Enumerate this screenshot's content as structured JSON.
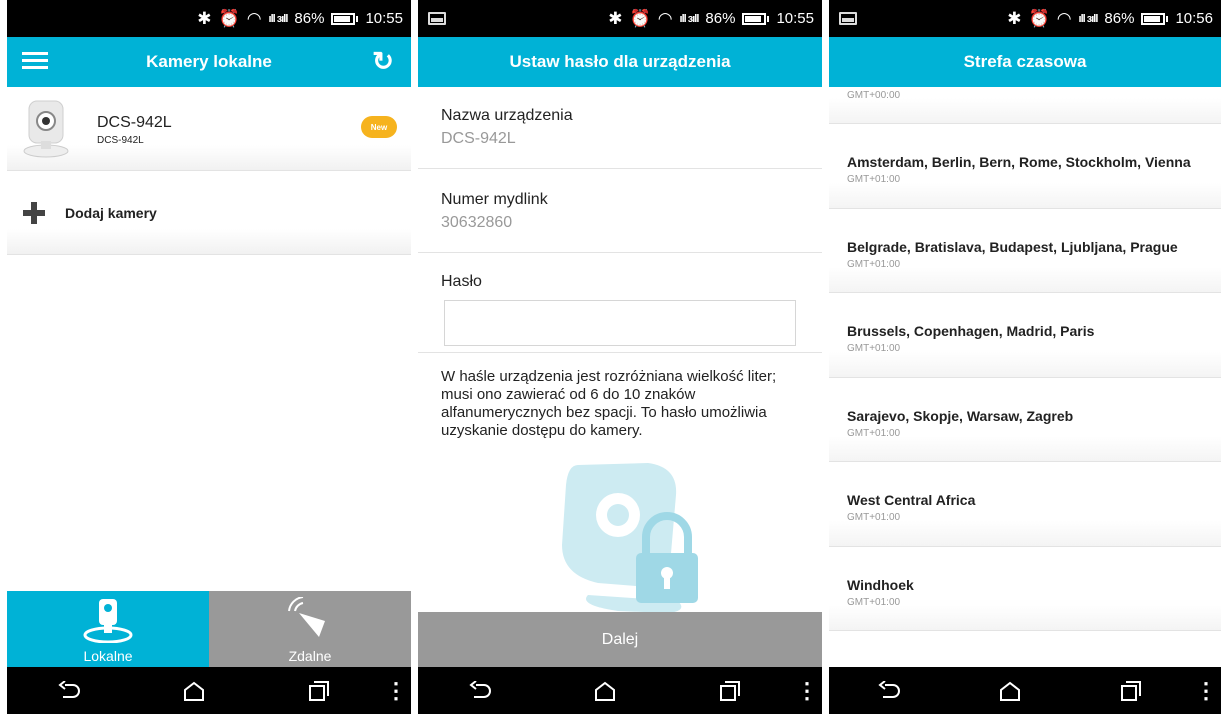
{
  "status": {
    "left_time": "10:55",
    "middle_time": "10:55",
    "right_time": "10:56",
    "battery": "86%"
  },
  "screen1": {
    "title": "Kamery lokalne",
    "camera": {
      "name": "DCS-942L",
      "model": "DCS-942L",
      "badge": "New"
    },
    "add_label": "Dodaj kamery",
    "tabs": [
      {
        "label": "Lokalne",
        "active": true
      },
      {
        "label": "Zdalne",
        "active": false
      }
    ]
  },
  "screen2": {
    "title": "Ustaw hasło dla urządzenia",
    "device_name_label": "Nazwa urządzenia",
    "device_name_value": "DCS-942L",
    "mydlink_label": "Numer mydlink",
    "mydlink_value": "30632860",
    "password_label": "Hasło",
    "password_value": "",
    "hint": "W haśle urządzenia jest rozróżniana wielkość liter; musi ono zawierać od 6 do 10 znaków alfanumerycznych bez spacji. To hasło umożliwia uzyskanie dostępu do kamery.",
    "next_button": "Dalej"
  },
  "screen3": {
    "title": "Strefa czasowa",
    "items": [
      {
        "name": "",
        "offset": "GMT+00:00"
      },
      {
        "name": "Amsterdam, Berlin, Bern, Rome, Stockholm, Vienna",
        "offset": "GMT+01:00"
      },
      {
        "name": "Belgrade, Bratislava, Budapest, Ljubljana, Prague",
        "offset": "GMT+01:00"
      },
      {
        "name": "Brussels, Copenhagen, Madrid, Paris",
        "offset": "GMT+01:00"
      },
      {
        "name": "Sarajevo, Skopje, Warsaw, Zagreb",
        "offset": "GMT+01:00"
      },
      {
        "name": "West Central Africa",
        "offset": "GMT+01:00"
      },
      {
        "name": "Windhoek",
        "offset": "GMT+01:00"
      }
    ]
  },
  "colors": {
    "accent": "#00b2d6",
    "badge": "#f6b31e",
    "tab_inactive": "#999999"
  }
}
